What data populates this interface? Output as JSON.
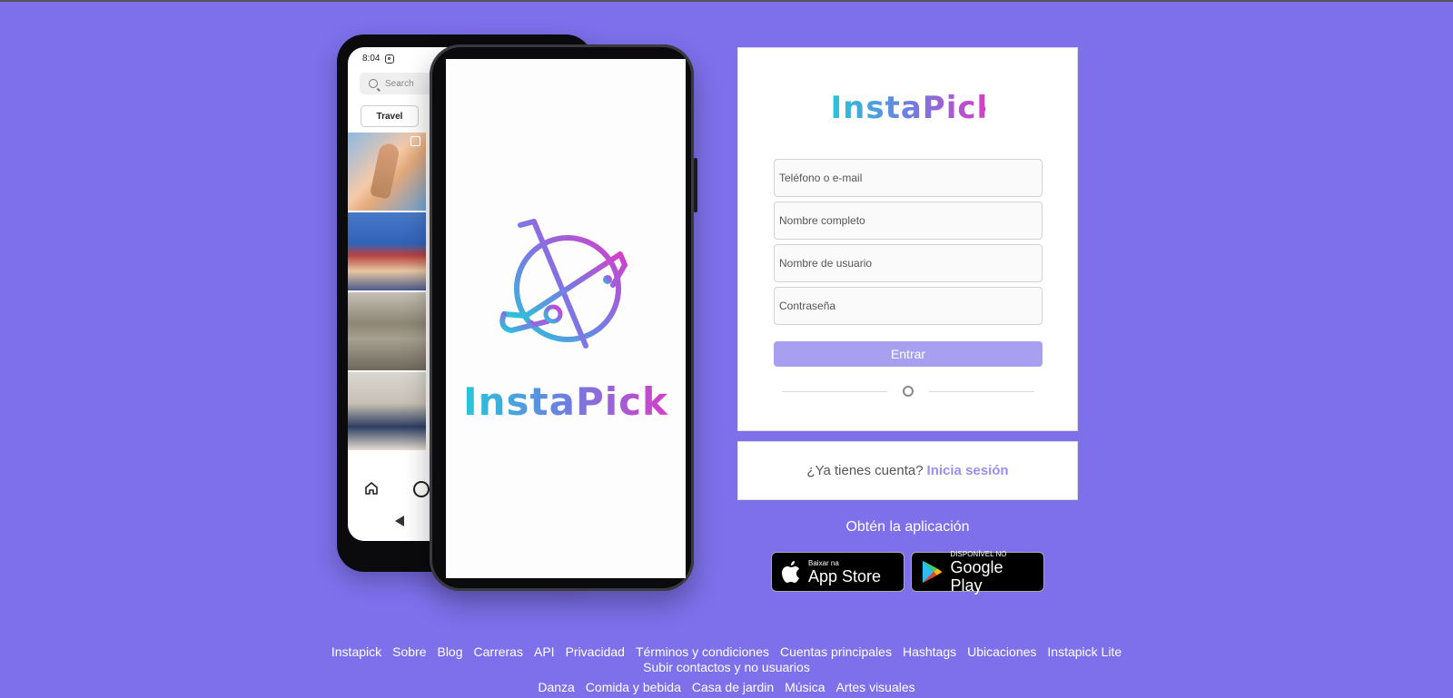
{
  "colors": {
    "background": "#7e70eb",
    "button": "#a89ff0",
    "link": "#9a8ff0",
    "gradient_start": "#27c6d9",
    "gradient_end": "#d63ec9"
  },
  "back_phone": {
    "time": "8:04",
    "search_placeholder": "Search",
    "chip_label": "Travel",
    "icons": [
      "instagram-icon",
      "search-icon",
      "home-icon",
      "back-icon"
    ]
  },
  "front_phone": {
    "logo_text": "InstaPick"
  },
  "form": {
    "brand": "InstaPick",
    "phone_placeholder": "Teléfono o e-mail",
    "fullname_placeholder": "Nombre completo",
    "username_placeholder": "Nombre de usuario",
    "password_placeholder": "Contraseña",
    "submit_label": "Entrar",
    "divider_text": "o"
  },
  "login": {
    "prompt": "¿Ya tienes cuenta?",
    "link": "Inicia sesión"
  },
  "get_app": {
    "title": "Obtén la aplicación",
    "appstore_small": "Baixar na",
    "appstore_big": "App Store",
    "googleplay_small": "DISPONÍVEL NO",
    "googleplay_big": "Google Play"
  },
  "footer": {
    "row1": [
      "Instapick",
      "Sobre",
      "Blog",
      "Carreras",
      "API",
      "Privacidad",
      "Términos y condiciones",
      "Cuentas principales",
      "Hashtags",
      "Ubicaciones",
      "Instapick Lite"
    ],
    "row2": [
      "Subir contactos y no usuarios"
    ],
    "row3": [
      "Danza",
      "Comida y bebida",
      "Casa de jardin",
      "Música",
      "Artes visuales"
    ]
  }
}
